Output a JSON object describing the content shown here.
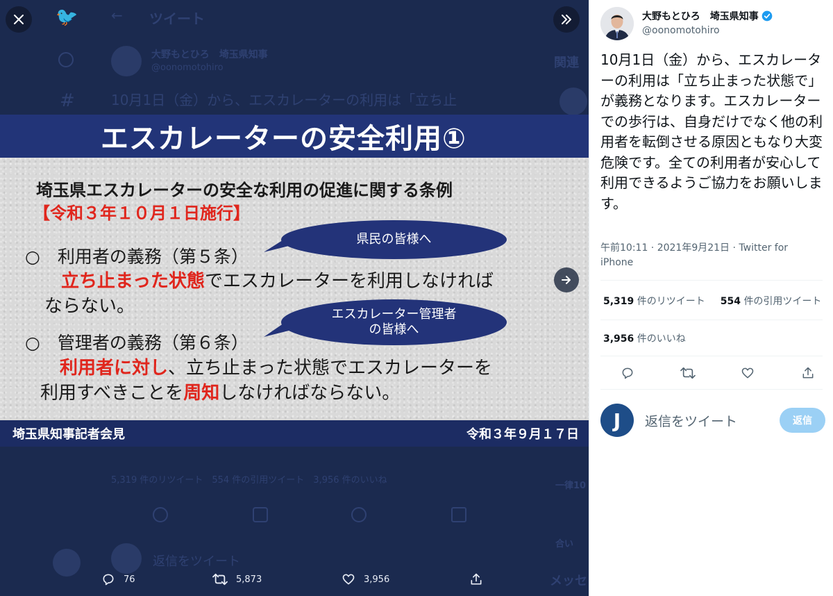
{
  "background_tweet": {
    "header_title": "ツイート",
    "author_name": "大野もとひろ　埼玉県知事",
    "author_handle": "@oonomotohiro",
    "text_line1": "10月1日（金）から、エスカレーターの利用は「立ち止",
    "stats_line": "5,319 件のリツイート　554 件の引用ツイート　3,956 件のいいね",
    "reply_placeholder": "返信をツイート",
    "related_label": "関連",
    "trend_a": "一律10",
    "trend_b": "合い",
    "messages_label": "メッセ"
  },
  "slide": {
    "title": "エスカレーターの安全利用①",
    "ordinance": "埼玉県エスカレーターの安全な利用の促進に関する条例",
    "effective": "【令和３年１０月１日施行】",
    "item1_heading": "○　利用者の義務（第５条）",
    "item1_red": "立ち止まった状態",
    "item1_rest": "でエスカレーターを利用しなければ",
    "item1_line2": "ならない。",
    "bubble1": "県民の皆様へ",
    "item2_heading": "○　管理者の義務（第６条）",
    "item2_red": "利用者に対し",
    "item2_rest": "、立ち止まった状態でエスカレーターを",
    "item2_line2a": "利用すべきことを",
    "item2_line2_red": "周知",
    "item2_line2b": "しなければならない。",
    "bubble2_line1": "エスカレーター管理者",
    "bubble2_line2": "の皆様へ",
    "footer_left": "埼玉県知事記者会見",
    "footer_right": "令和３年９月１７日"
  },
  "viewer_actions": {
    "replies": "76",
    "retweets": "5,873",
    "likes": "3,956"
  },
  "tweet": {
    "author_name": "大野もとひろ　埼玉県知事",
    "author_handle": "@oonomotohiro",
    "verified": true,
    "text": "10月1日（金）から、エスカレーターの利用は「立ち止まった状態で」が義務となります。エスカレーターでの歩行は、自身だけでなく他の利用者を転倒させる原因ともなり大変危険です。全ての利用者が安心して利用できるようご協力をお願いします。",
    "timestamp": "午前10:11 · 2021年9月21日 · Twitter for iPhone",
    "retweets_count": "5,319",
    "retweets_label": "件のリツイート",
    "quotes_count": "554",
    "quotes_label": "件の引用ツイート",
    "likes_count": "3,956",
    "likes_label": "件のいいね",
    "reply_placeholder": "返信をツイート",
    "reply_button": "返信",
    "reply_avatar_letter": "J"
  },
  "colors": {
    "viewer_bg": "#1b2a4f",
    "slide_header": "#223478",
    "accent_red": "#e0261d",
    "twitter_blue": "#1d9bf0",
    "reply_button": "#9bd0f5"
  },
  "icons": [
    "close-icon",
    "expand-icon",
    "next-arrow-icon",
    "reply-icon",
    "retweet-icon",
    "like-icon",
    "share-icon",
    "verified-icon"
  ]
}
